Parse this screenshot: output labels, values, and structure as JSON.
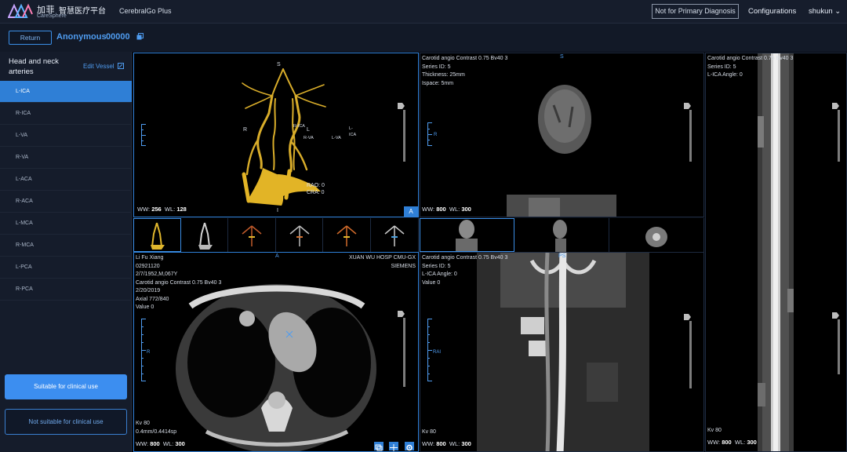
{
  "brand": {
    "name_cn": "加菲",
    "platform_cn": "智慧医疗平台",
    "name_en": "CareSphere",
    "app_name": "CerebralGo Plus"
  },
  "header": {
    "diagnosis_badge": "Not for Primary Diagnosis",
    "configurations": "Configurations",
    "user": "shukun ⌄"
  },
  "subheader": {
    "return_label": "Return",
    "patient_name": "Anonymous",
    "patient_id": "00000"
  },
  "sidebar": {
    "title": "Head and neck arteries",
    "edit_label": "Edit Vessel",
    "vessels": [
      "L-ICA",
      "R-ICA",
      "L-VA",
      "R-VA",
      "L-ACA",
      "R-ACA",
      "L-MCA",
      "R-MCA",
      "L-PCA",
      "R-PCA"
    ],
    "selected_index": 0,
    "suitable_label": "Suitable for clinical use",
    "not_suitable_label": "Not suitable for clinical use"
  },
  "viewports": {
    "vr": {
      "orient_top": "S",
      "orient_bottom": "I",
      "orient_left": "R",
      "labels": {
        "r_ica": "R-ICA",
        "l": "L",
        "r_va": "R-VA",
        "l_va": "L-VA",
        "l_ica_1": "L-",
        "l_ica_2": "ICA"
      },
      "angles": [
        "RAO: 0",
        "CRA: 0"
      ],
      "ww_label": "WW:",
      "ww": "256",
      "wl_label": "WL:",
      "wl": "128",
      "corner_tag": "A"
    },
    "coronal_mpr": {
      "lines": [
        "Carotid angio Contrast 0.75 Bv40 3",
        "Series ID: 5",
        "Thickness: 25mm",
        "Ispace: 5mm"
      ],
      "orient_top": "S",
      "orient_left": "R",
      "ww_label": "WW:",
      "ww": "800",
      "wl_label": "WL:",
      "wl": "300"
    },
    "straightened": {
      "lines": [
        "Carotid angio Contrast 0.75 Bv40 3",
        "Series ID: 5",
        "L-ICA Angle: 0"
      ],
      "kv": "Kv 80",
      "ww_label": "WW:",
      "ww": "800",
      "wl_label": "WL:",
      "wl": "300"
    },
    "axial": {
      "left_lines": [
        "Li Fu Xiang",
        "02921120",
        "2/7/1952,M,067Y",
        "Carotid angio Contrast 0.75 Bv40 3",
        "2/20/2019",
        "Axial 772/840",
        "Value 0"
      ],
      "right_lines": [
        "XUAN WU HOSP CMU-GX",
        "SIEMENS"
      ],
      "orient_top": "A",
      "orient_left": "R",
      "bottom_lines": [
        "Kv 80",
        "0.4mm/0.4414sp"
      ],
      "ww_label": "WW:",
      "ww": "800",
      "wl_label": "WL:",
      "wl": "300"
    },
    "curved": {
      "lines": [
        "Carotid angio Contrast 0.75 Bv40 3",
        "Series ID: 5",
        "L-ICA Angle: 0",
        "Value 0"
      ],
      "orient_top": "PS",
      "orient_left": "RAI",
      "kv": "Kv 80",
      "ww_label": "WW:",
      "ww": "800",
      "wl_label": "WL:",
      "wl": "300"
    }
  },
  "colors": {
    "accent": "#2f7fd6",
    "link": "#4f9cf0",
    "vessel": "#e0b62c",
    "panel": "#151c2b"
  }
}
